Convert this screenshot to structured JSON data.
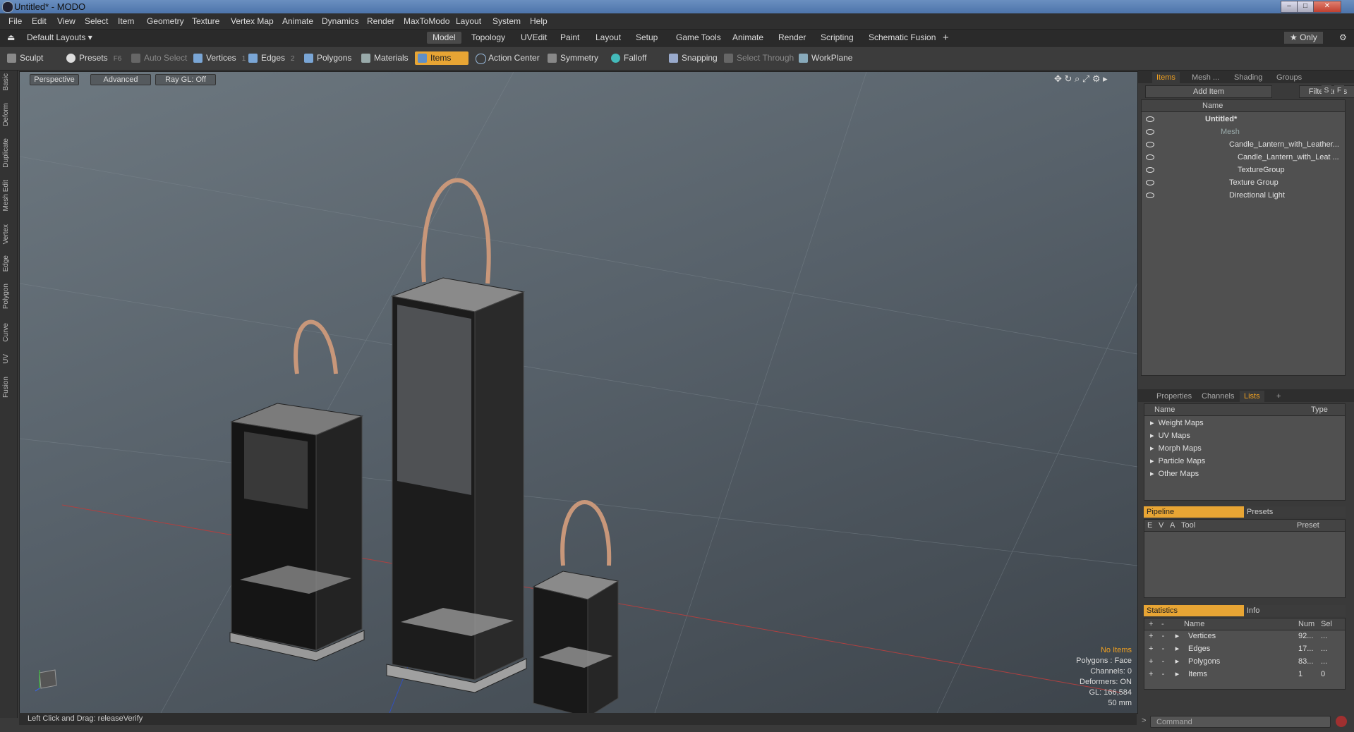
{
  "window": {
    "title": "Untitled* - MODO",
    "controls": [
      "–",
      "□",
      "✕"
    ]
  },
  "menu": [
    "File",
    "Edit",
    "View",
    "Select",
    "Item",
    "Geometry",
    "Texture",
    "Vertex Map",
    "Animate",
    "Dynamics",
    "Render",
    "MaxToModo",
    "Layout",
    "System",
    "Help"
  ],
  "layouts": {
    "selector": "Default Layouts ▾",
    "tabs": [
      "Model",
      "Topology",
      "UVEdit",
      "Paint",
      "Layout",
      "Setup",
      "Game Tools",
      "Animate",
      "Render",
      "Scripting",
      "Schematic Fusion"
    ],
    "active_tab": "Model",
    "add": "+",
    "only": "★ Only",
    "gear": "⚙"
  },
  "toolbar": {
    "sculpt": "Sculpt",
    "presets": "Presets",
    "presets_key": "F6",
    "auto_select": "Auto Select",
    "vertices": "Vertices",
    "vertices_count": "1",
    "edges": "Edges",
    "edges_count": "2",
    "polygons": "Polygons",
    "materials": "Materials",
    "items": "Items",
    "action_center": "Action Center",
    "symmetry": "Symmetry",
    "falloff": "Falloff",
    "snapping": "Snapping",
    "select_through": "Select Through",
    "workplane": "WorkPlane"
  },
  "left_tabs": [
    "Basic",
    "Deform",
    "Duplicate",
    "Mesh Edit",
    "Vertex",
    "Edge",
    "Polygon",
    "Curve",
    "UV",
    "Fusion"
  ],
  "viewport": {
    "view_mode": "Perspective",
    "shading": "Advanced",
    "raygl": "Ray GL: Off",
    "stats": {
      "no_items": "No Items",
      "polygons": "Polygons : Face",
      "channels": "Channels: 0",
      "deformers": "Deformers: ON",
      "gl": "GL: 166,584",
      "scale": "50 mm"
    }
  },
  "status": {
    "hint": "Left Click and Drag:  releaseVerify"
  },
  "items_panel": {
    "tabs": [
      "Items",
      "Mesh ...",
      "Shading",
      "Groups"
    ],
    "add_item": "Add Item",
    "filter": "Filter Items",
    "s_btn": "S",
    "f_btn": "F",
    "name_header": "Name",
    "rows": [
      {
        "label": "Untitled*"
      },
      {
        "label": "Mesh"
      },
      {
        "label": "Candle_Lantern_with_Leather..."
      },
      {
        "label": "Candle_Lantern_with_Leat ..."
      },
      {
        "label": "TextureGroup"
      },
      {
        "label": "Texture Group"
      },
      {
        "label": "Directional Light"
      }
    ]
  },
  "lists_panel": {
    "tabs": [
      "Properties",
      "Channels",
      "Lists",
      "+"
    ],
    "name_header": "Name",
    "type_header": "Type",
    "rows": [
      "Weight Maps",
      "UV Maps",
      "Morph Maps",
      "Particle Maps",
      "Other Maps"
    ]
  },
  "pipeline_panel": {
    "tab_pipeline": "Pipeline",
    "tab_presets": "Presets",
    "headers": [
      "E",
      "V",
      "A",
      "Tool",
      "Preset"
    ]
  },
  "statistics_panel": {
    "tab_statistics": "Statistics",
    "tab_info": "Info",
    "headers": [
      "+",
      "-",
      "Name",
      "Num",
      "Sel"
    ],
    "rows": [
      {
        "name": "Vertices",
        "num": "92...",
        "sel": "..."
      },
      {
        "name": "Edges",
        "num": "17...",
        "sel": "..."
      },
      {
        "name": "Polygons",
        "num": "83...",
        "sel": "..."
      },
      {
        "name": "Items",
        "num": "1",
        "sel": "0"
      }
    ]
  },
  "command": {
    "placeholder": "Command"
  },
  "colors": {
    "accent": "#e8a534",
    "viewport_top": "#6d7880",
    "viewport_bottom": "#3d444b"
  }
}
